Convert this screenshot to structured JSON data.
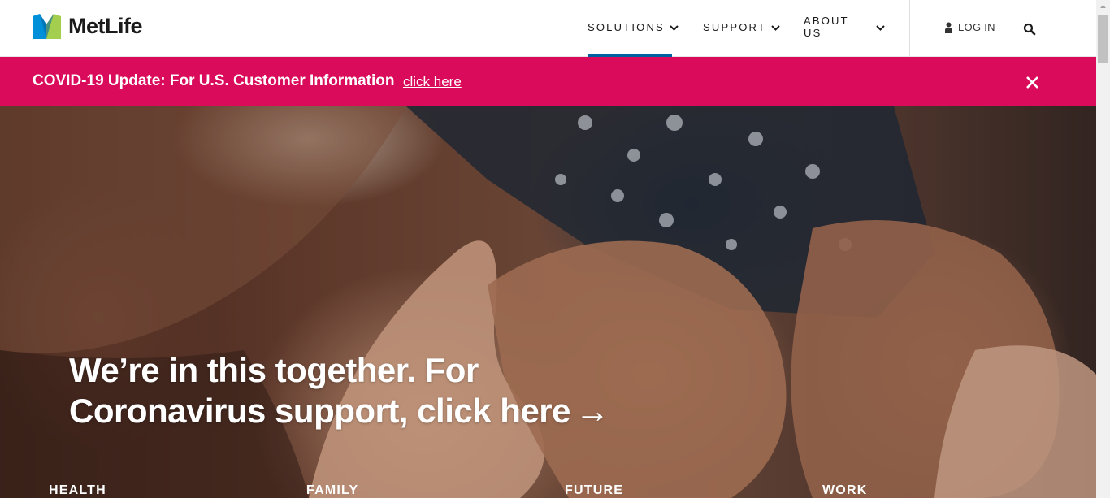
{
  "header": {
    "logo_text": "MetLife",
    "nav": [
      {
        "label": "SOLUTIONS"
      },
      {
        "label": "SUPPORT"
      },
      {
        "label": "ABOUT US"
      }
    ],
    "login_label": "LOG IN"
  },
  "alert": {
    "text": "COVID-19 Update: For U.S. Customer Information",
    "link_label": "click here"
  },
  "hero": {
    "title": "We’re in this together. For Coronavirus support, click here",
    "arrow": "→",
    "categories": [
      "HEALTH",
      "FAMILY",
      "FUTURE",
      "WORK"
    ]
  },
  "colors": {
    "alert_bg": "#d90b5a",
    "nav_active": "#0061a0",
    "logo_blue": "#0090da",
    "logo_green": "#a4ce4e"
  },
  "icons": {
    "logo": "metlife-logo-icon",
    "chevron": "chevron-down-icon",
    "user": "user-icon",
    "search": "search-icon",
    "close": "close-icon"
  }
}
